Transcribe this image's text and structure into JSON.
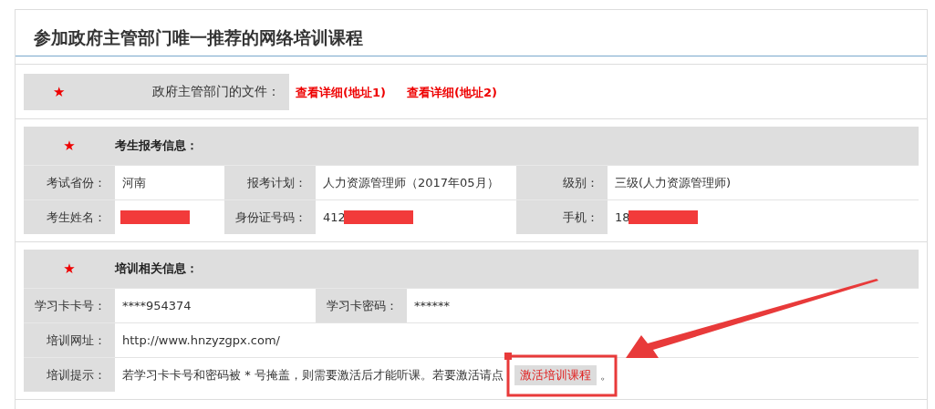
{
  "title": "参加政府主管部门唯一推荐的网络培训课程",
  "documents": {
    "marker": "★",
    "label": "政府主管部门的文件：",
    "links": [
      "查看详细(地址1)",
      "查看详细(地址2)"
    ]
  },
  "sections": [
    {
      "marker": "★",
      "heading": "考生报考信息：",
      "rows": [
        [
          {
            "label": "考试省份：",
            "value": "河南"
          },
          {
            "label": "报考计划：",
            "value": "人力资源管理师（2017年05月）"
          },
          {
            "label": "级别：",
            "value": "三级(人力资源管理师)"
          }
        ],
        [
          {
            "label": "考生姓名：",
            "redacted": true
          },
          {
            "label": "身份证号码：",
            "value": "412",
            "redacted": true
          },
          {
            "label": "手机：",
            "value": "18",
            "redacted": true
          }
        ]
      ]
    },
    {
      "marker": "★",
      "heading": "培训相关信息：",
      "rows": [
        [
          {
            "label": "学习卡卡号：",
            "value": "****954374"
          },
          {
            "label": "学习卡密码：",
            "value": "******"
          }
        ],
        [
          {
            "label": "培训网址：",
            "value": "http://www.hnzyzgpx.com/"
          }
        ],
        [
          {
            "label": "培训提示：",
            "value": "若学习卡卡号和密码被 * 号掩盖，则需要激活后才能听课。若要激活请点",
            "link": "激活培训课程",
            "suffix": "。"
          }
        ]
      ]
    }
  ]
}
